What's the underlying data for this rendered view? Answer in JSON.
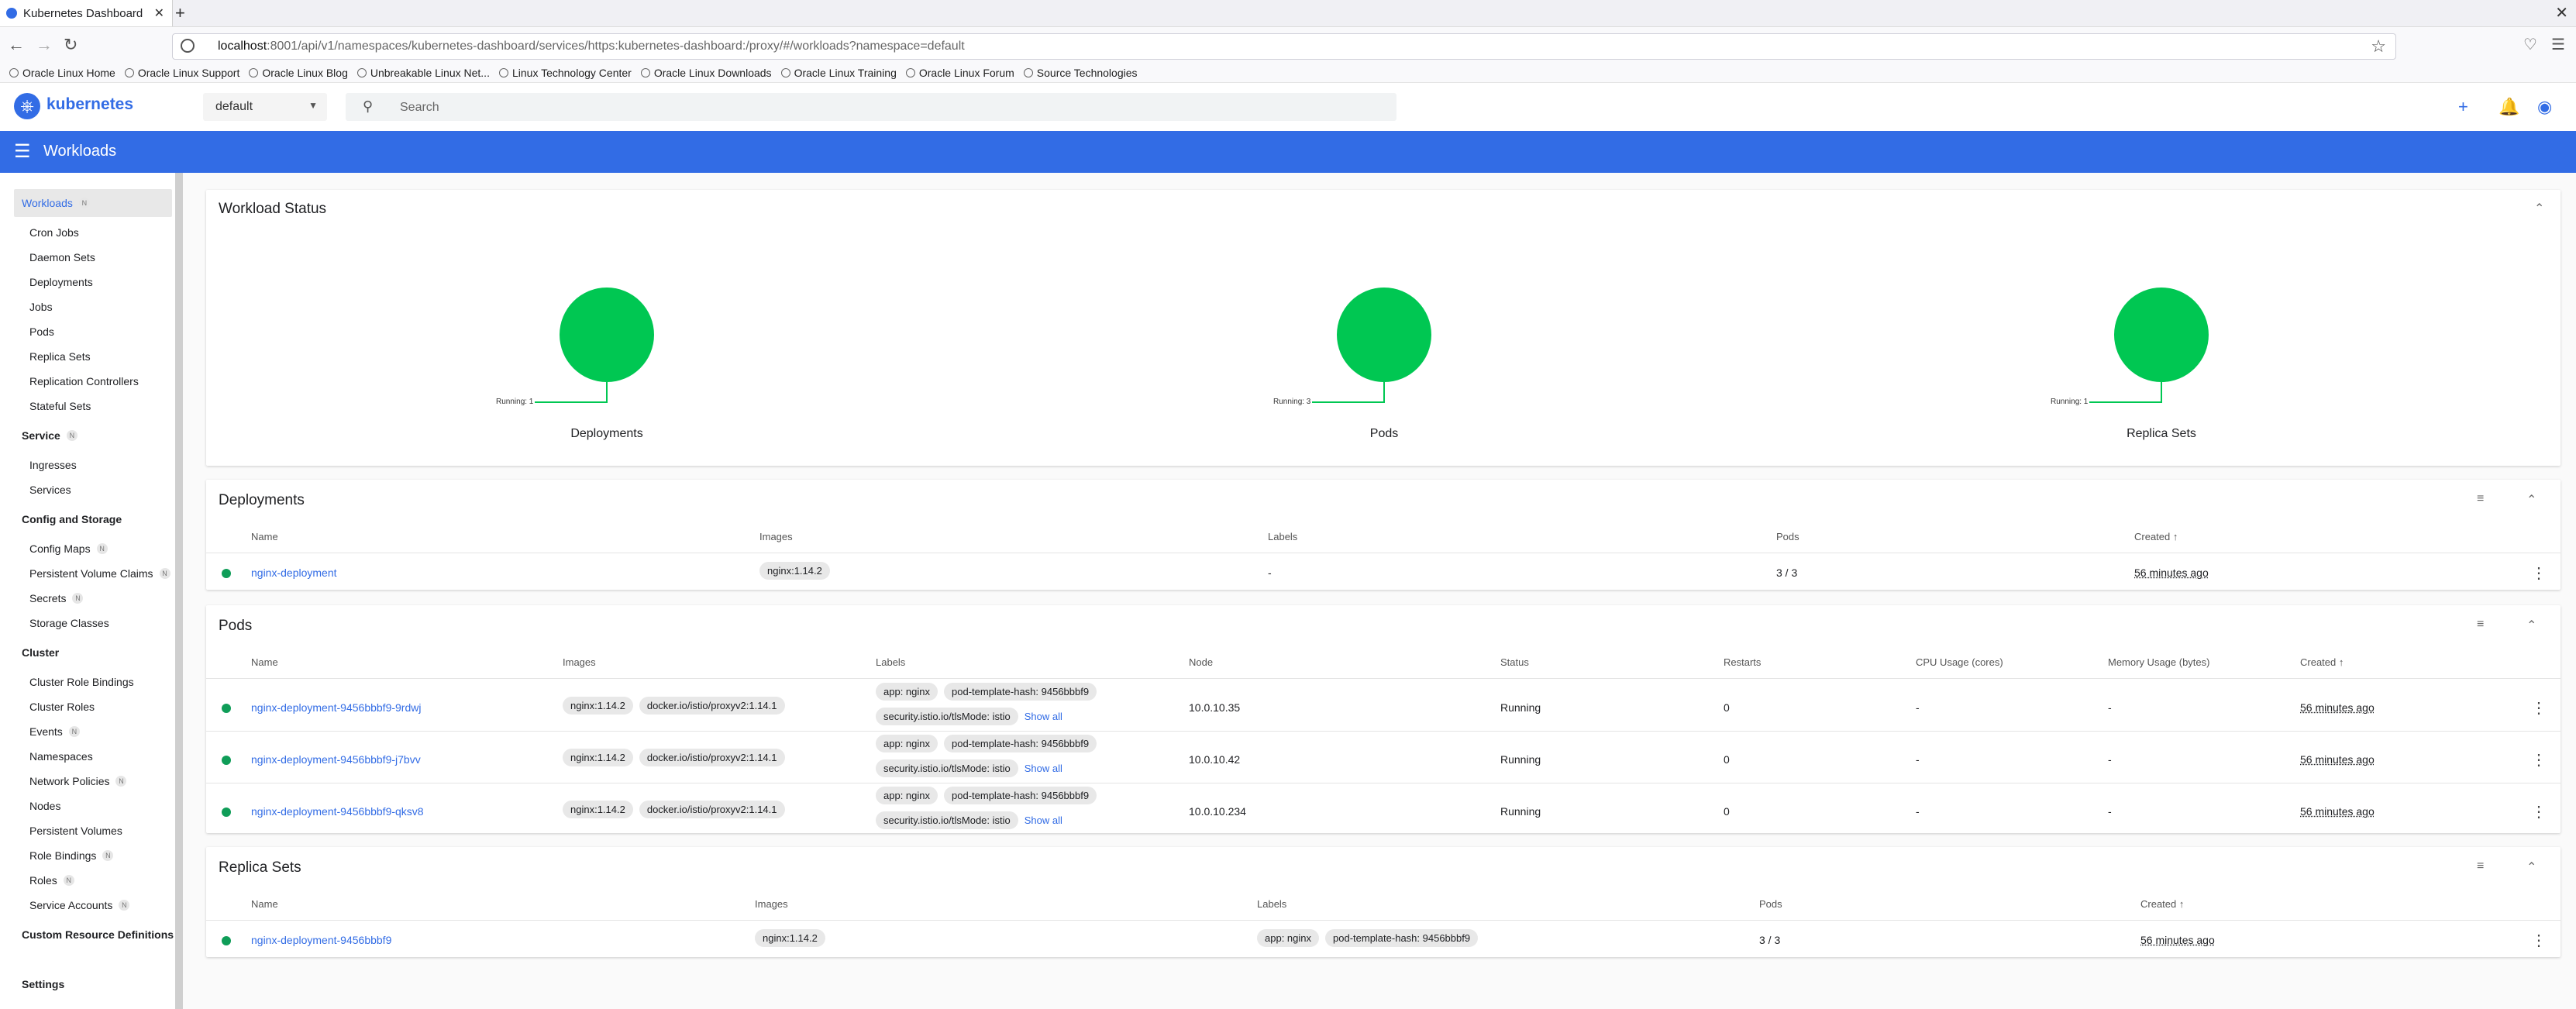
{
  "browser": {
    "tab_title": "Kubernetes Dashboard",
    "url_host": "localhost",
    "url_rest": ":8001/api/v1/namespaces/kubernetes-dashboard/services/https:kubernetes-dashboard:/proxy/#/workloads?namespace=default",
    "bookmarks": [
      "Oracle Linux Home",
      "Oracle Linux Support",
      "Oracle Linux Blog",
      "Unbreakable Linux Net...",
      "Linux Technology Center",
      "Oracle Linux Downloads",
      "Oracle Linux Training",
      "Oracle Linux Forum",
      "Source Technologies"
    ]
  },
  "header": {
    "brand": "kubernetes",
    "namespace": "default",
    "search_placeholder": "Search"
  },
  "toolbar": {
    "title": "Workloads"
  },
  "sidebar": {
    "workloads": "Workloads",
    "workload_items": [
      "Cron Jobs",
      "Daemon Sets",
      "Deployments",
      "Jobs",
      "Pods",
      "Replica Sets",
      "Replication Controllers",
      "Stateful Sets"
    ],
    "service": "Service",
    "service_items": [
      "Ingresses",
      "Services"
    ],
    "config": "Config and Storage",
    "config_items": [
      "Config Maps",
      "Persistent Volume Claims",
      "Secrets",
      "Storage Classes"
    ],
    "cluster": "Cluster",
    "cluster_items": [
      "Cluster Role Bindings",
      "Cluster Roles",
      "Events",
      "Namespaces",
      "Network Policies",
      "Nodes",
      "Persistent Volumes",
      "Role Bindings",
      "Roles",
      "Service Accounts"
    ],
    "crd": "Custom Resource Definitions",
    "settings": "Settings",
    "badge": "N"
  },
  "workload_status": {
    "title": "Workload Status",
    "charts": [
      {
        "label": "Deployments",
        "running": "Running: 1"
      },
      {
        "label": "Pods",
        "running": "Running: 3"
      },
      {
        "label": "Replica Sets",
        "running": "Running: 1"
      }
    ]
  },
  "deployments": {
    "title": "Deployments",
    "columns": [
      "Name",
      "Images",
      "Labels",
      "Pods",
      "Created"
    ],
    "rows": [
      {
        "name": "nginx-deployment",
        "image": "nginx:1.14.2",
        "labels": "-",
        "pods": "3 / 3",
        "created": "56 minutes ago"
      }
    ]
  },
  "pods": {
    "title": "Pods",
    "columns": [
      "Name",
      "Images",
      "Labels",
      "Node",
      "Status",
      "Restarts",
      "CPU Usage (cores)",
      "Memory Usage (bytes)",
      "Created"
    ],
    "show_all": "Show all",
    "rows": [
      {
        "name": "nginx-deployment-9456bbbf9-9rdwj",
        "image1": "nginx:1.14.2",
        "image2": "docker.io/istio/proxyv2:1.14.1",
        "label1": "app: nginx",
        "label2": "pod-template-hash: 9456bbbf9",
        "label3": "security.istio.io/tlsMode: istio",
        "node": "10.0.10.35",
        "status": "Running",
        "restarts": "0",
        "cpu": "-",
        "mem": "-",
        "created": "56 minutes ago"
      },
      {
        "name": "nginx-deployment-9456bbbf9-j7bvv",
        "image1": "nginx:1.14.2",
        "image2": "docker.io/istio/proxyv2:1.14.1",
        "label1": "app: nginx",
        "label2": "pod-template-hash: 9456bbbf9",
        "label3": "security.istio.io/tlsMode: istio",
        "node": "10.0.10.42",
        "status": "Running",
        "restarts": "0",
        "cpu": "-",
        "mem": "-",
        "created": "56 minutes ago"
      },
      {
        "name": "nginx-deployment-9456bbbf9-qksv8",
        "image1": "nginx:1.14.2",
        "image2": "docker.io/istio/proxyv2:1.14.1",
        "label1": "app: nginx",
        "label2": "pod-template-hash: 9456bbbf9",
        "label3": "security.istio.io/tlsMode: istio",
        "node": "10.0.10.234",
        "status": "Running",
        "restarts": "0",
        "cpu": "-",
        "mem": "-",
        "created": "56 minutes ago"
      }
    ]
  },
  "replica_sets": {
    "title": "Replica Sets",
    "columns": [
      "Name",
      "Images",
      "Labels",
      "Pods",
      "Created"
    ],
    "rows": [
      {
        "name": "nginx-deployment-9456bbbf9",
        "image": "nginx:1.14.2",
        "label1": "app: nginx",
        "label2": "pod-template-hash: 9456bbbf9",
        "pods": "3 / 3",
        "created": "56 minutes ago"
      }
    ]
  },
  "colors": {
    "brand": "#326ce5",
    "running": "#00c752",
    "status_dot": "#0f9d58"
  }
}
